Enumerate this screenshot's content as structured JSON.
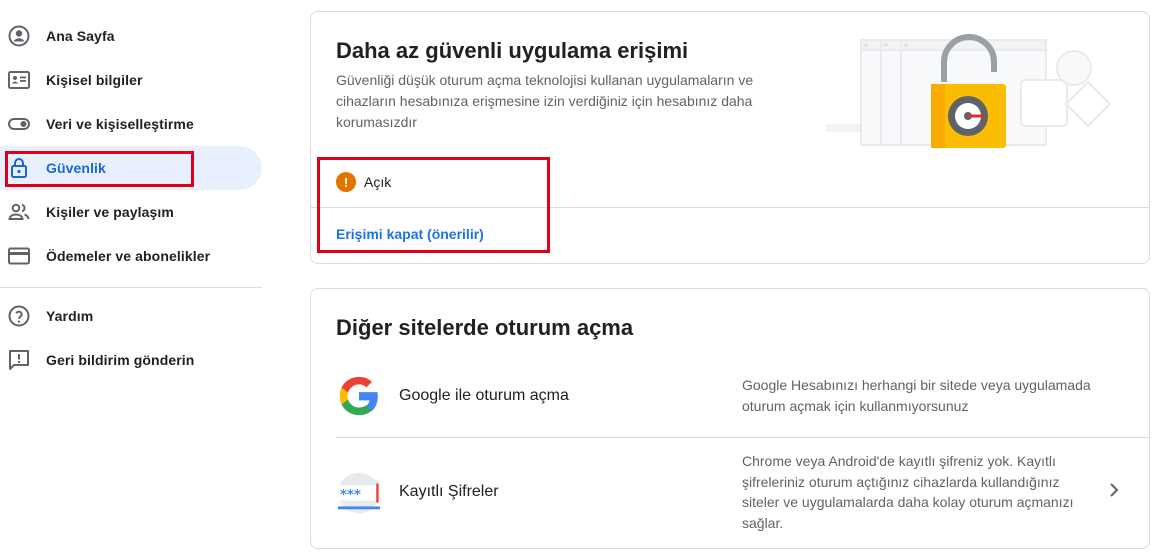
{
  "sidebar": {
    "items": [
      {
        "label": "Ana Sayfa",
        "icon": "account-circle-icon"
      },
      {
        "label": "Kişisel bilgiler",
        "icon": "id-card-icon"
      },
      {
        "label": "Veri ve kişiselleştirme",
        "icon": "toggle-icon"
      },
      {
        "label": "Güvenlik",
        "icon": "lock-icon",
        "active": true
      },
      {
        "label": "Kişiler ve paylaşım",
        "icon": "people-icon"
      },
      {
        "label": "Ödemeler ve abonelikler",
        "icon": "credit-card-icon"
      }
    ],
    "secondary": [
      {
        "label": "Yardım",
        "icon": "help-icon"
      },
      {
        "label": "Geri bildirim gönderin",
        "icon": "feedback-icon"
      }
    ]
  },
  "less_secure": {
    "title": "Daha az güvenli uygulama erişimi",
    "description": "Güvenliği düşük oturum açma teknolojisi kullanan uygulamaların ve cihazların hesabınıza erişmesine izin verdiğiniz için hesabınız daha korumasızdır",
    "status": "Açık",
    "action": "Erişimi kapat (önerilir)"
  },
  "other_sites": {
    "title": "Diğer sitelerde oturum açma",
    "rows": [
      {
        "title": "Google ile oturum açma",
        "description": "Google Hesabınızı herhangi bir sitede veya uygulamada oturum açmak için kullanmıyorsunuz",
        "icon": "google-icon"
      },
      {
        "title": "Kayıtlı Şifreler",
        "description": "Chrome veya Android'de kayıtlı şifreniz yok. Kayıtlı şifreleriniz oturum açtığınız cihazlarda kullandığınız siteler ve uygulamalarda daha kolay oturum açmanızı sağlar.",
        "icon": "password-icon"
      }
    ]
  },
  "colors": {
    "accent": "#1a73e8",
    "active_bg": "#e8f0fe",
    "warning": "#e37400",
    "highlight": "#e0001b"
  }
}
